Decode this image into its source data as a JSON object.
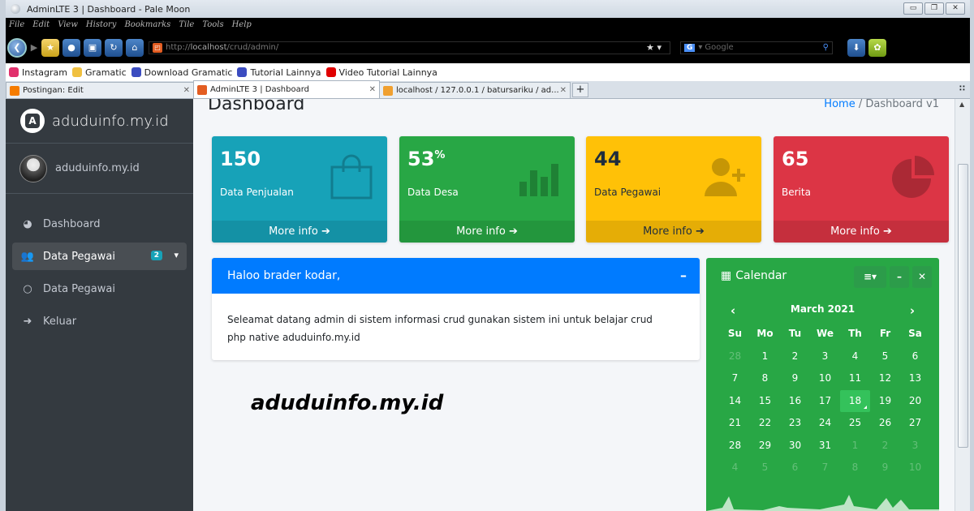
{
  "window": {
    "title": "AdminLTE 3 | Dashboard - Pale Moon"
  },
  "menubar": [
    "File",
    "Edit",
    "View",
    "History",
    "Bookmarks",
    "Tile",
    "Tools",
    "Help"
  ],
  "navbar": {
    "url_prefix": "http://",
    "url_host": "localhost",
    "url_path": "/crud/admin/",
    "search_placeholder": "Google"
  },
  "bookmarks": [
    {
      "label": "Instagram",
      "color": "#e1306c"
    },
    {
      "label": "Gramatic",
      "color": "#f0c040"
    },
    {
      "label": "Download Gramatic",
      "color": "#3b4cc0"
    },
    {
      "label": "Tutorial Lainnya",
      "color": "#3b4cc0"
    },
    {
      "label": "Video Tutorial Lainnya",
      "color": "#e00000"
    }
  ],
  "tabs": [
    {
      "label": "Postingan: Edit",
      "color": "#f57c00"
    },
    {
      "label": "AdminLTE 3 | Dashboard",
      "color": "#e35d22"
    },
    {
      "label": "localhost / 127.0.0.1 / batursariku / ad...",
      "color": "#f0a030"
    }
  ],
  "sidebar": {
    "brand": "aduduinfo.my.id",
    "user": "aduduinfo.my.id",
    "items": [
      {
        "label": "Dashboard",
        "icon": "tachometer-icon"
      },
      {
        "label": "Data Pegawai",
        "icon": "users-icon",
        "badge": "2"
      },
      {
        "label": "Data Pegawai",
        "icon": "circle-icon"
      },
      {
        "label": "Keluar",
        "icon": "sign-out-icon"
      }
    ]
  },
  "page": {
    "title": "Dashboard",
    "breadcrumb_home": "Home",
    "breadcrumb_sep": "/",
    "breadcrumb_current": "Dashboard v1"
  },
  "boxes": [
    {
      "value": "150",
      "suffix": "",
      "label": "Data Penjualan",
      "footer": "More info",
      "icon": "shopping-bag-icon",
      "color": "#17a2b8"
    },
    {
      "value": "53",
      "suffix": "%",
      "label": "Data Desa",
      "footer": "More info",
      "icon": "bar-chart-icon",
      "color": "#28a745"
    },
    {
      "value": "44",
      "suffix": "",
      "label": "Data Pegawai",
      "footer": "More info",
      "icon": "user-plus-icon",
      "color": "#ffc107"
    },
    {
      "value": "65",
      "suffix": "",
      "label": "Berita",
      "footer": "More info",
      "icon": "pie-chart-icon",
      "color": "#dc3545"
    }
  ],
  "welcome": {
    "title": "Haloo brader kodar,",
    "body": "Seleamat datang admin di sistem informasi crud gunakan sistem ini untuk belajar crud php native aduduinfo.my.id",
    "collapse": "–"
  },
  "watermark": "aduduinfo.my.id",
  "calendar": {
    "title": "Calendar",
    "month": "March 2021",
    "prev": "‹",
    "next": "›",
    "dow": [
      "Su",
      "Mo",
      "Tu",
      "We",
      "Th",
      "Fr",
      "Sa"
    ],
    "days": [
      {
        "d": "28",
        "m": true
      },
      {
        "d": "1"
      },
      {
        "d": "2"
      },
      {
        "d": "3"
      },
      {
        "d": "4"
      },
      {
        "d": "5"
      },
      {
        "d": "6"
      },
      {
        "d": "7"
      },
      {
        "d": "8"
      },
      {
        "d": "9"
      },
      {
        "d": "10"
      },
      {
        "d": "11"
      },
      {
        "d": "12"
      },
      {
        "d": "13"
      },
      {
        "d": "14"
      },
      {
        "d": "15"
      },
      {
        "d": "16"
      },
      {
        "d": "17"
      },
      {
        "d": "18",
        "t": true
      },
      {
        "d": "19"
      },
      {
        "d": "20"
      },
      {
        "d": "21"
      },
      {
        "d": "22"
      },
      {
        "d": "23"
      },
      {
        "d": "24"
      },
      {
        "d": "25"
      },
      {
        "d": "26"
      },
      {
        "d": "27"
      },
      {
        "d": "28"
      },
      {
        "d": "29"
      },
      {
        "d": "30"
      },
      {
        "d": "31"
      },
      {
        "d": "1",
        "m": true
      },
      {
        "d": "2",
        "m": true
      },
      {
        "d": "3",
        "m": true
      },
      {
        "d": "4",
        "m": true
      },
      {
        "d": "5",
        "m": true
      },
      {
        "d": "6",
        "m": true
      },
      {
        "d": "7",
        "m": true
      },
      {
        "d": "8",
        "m": true
      },
      {
        "d": "9",
        "m": true
      },
      {
        "d": "10",
        "m": true
      }
    ]
  }
}
